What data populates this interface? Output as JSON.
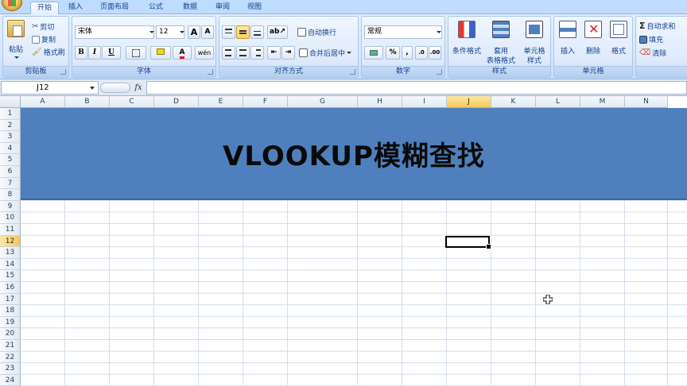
{
  "ribbon_tabs": [
    "开始",
    "插入",
    "页面布局",
    "公式",
    "数据",
    "审阅",
    "视图"
  ],
  "clipboard": {
    "paste": "粘贴",
    "cut": "剪切",
    "copy": "复制",
    "format_painter": "格式刷",
    "group_label": "剪贴板"
  },
  "font": {
    "family": "宋体",
    "size": "12",
    "grow_label": "A",
    "shrink_label": "A",
    "bold": "B",
    "italic": "I",
    "underline": "U",
    "color_letter": "A",
    "phonetic": "wén",
    "group_label": "字体"
  },
  "alignment": {
    "wrap_text": "自动换行",
    "merge_center": "合并后居中",
    "group_label": "对齐方式"
  },
  "number": {
    "format": "常规",
    "percent": "%",
    "comma": ",",
    "group_label": "数字"
  },
  "styles": {
    "conditional": "条件格式",
    "table_line1": "套用",
    "table_line2": "表格格式",
    "cell_styles_line1": "单元格",
    "cell_styles_line2": "样式",
    "group_label": "样式"
  },
  "cells_group": {
    "insert": "插入",
    "delete": "删除",
    "format": "格式",
    "group_label": "单元格"
  },
  "editing": {
    "autosum": "自动求和",
    "fill": "填充",
    "clear": "清除"
  },
  "formula_bar": {
    "name_box": "J12",
    "fx": "fx",
    "formula": ""
  },
  "columns": [
    "A",
    "B",
    "C",
    "D",
    "E",
    "F",
    "G",
    "H",
    "I",
    "J",
    "K",
    "L",
    "M",
    "N"
  ],
  "selected_column": "J",
  "rows": [
    "1",
    "2",
    "3",
    "4",
    "5",
    "6",
    "7",
    "8",
    "9",
    "10",
    "11",
    "12",
    "13",
    "14",
    "15",
    "16",
    "17",
    "18",
    "19",
    "20",
    "21",
    "22",
    "23",
    "24"
  ],
  "selected_row": "12",
  "sheet": {
    "title": "VLOOKUP模糊查找"
  },
  "colors": {
    "banner": "#4f80bd",
    "selection_header": "#f7c85c",
    "ribbon": "#d7e7fb"
  }
}
